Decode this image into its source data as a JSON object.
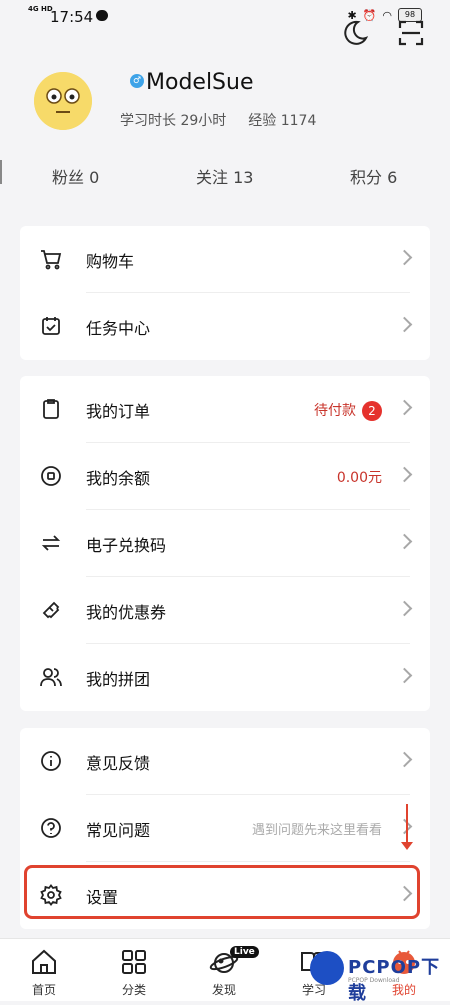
{
  "status_bar": {
    "network": "4G HD",
    "time": "17:54",
    "battery": "98"
  },
  "profile": {
    "username": "ModelSue",
    "gender_symbol": "♂",
    "study_time_label": "学习时长",
    "study_time_value": "29小时",
    "exp_label": "经验",
    "exp_value": "1174"
  },
  "counts": [
    {
      "label": "粉丝",
      "value": "0"
    },
    {
      "label": "关注",
      "value": "13"
    },
    {
      "label": "积分",
      "value": "6"
    }
  ],
  "group1": [
    {
      "label": "购物车",
      "icon": "cart-icon"
    },
    {
      "label": "任务中心",
      "icon": "calendar-check-icon"
    }
  ],
  "group2": [
    {
      "label": "我的订单",
      "icon": "clipboard-icon",
      "status": "待付款",
      "badge": "2"
    },
    {
      "label": "我的余额",
      "icon": "coin-icon",
      "amount": "0.00元"
    },
    {
      "label": "电子兑换码",
      "icon": "exchange-icon"
    },
    {
      "label": "我的优惠券",
      "icon": "ticket-icon"
    },
    {
      "label": "我的拼团",
      "icon": "group-icon"
    }
  ],
  "group3": [
    {
      "label": "意见反馈",
      "icon": "info-icon"
    },
    {
      "label": "常见问题",
      "icon": "question-icon",
      "hint": "遇到问题先来这里看看"
    },
    {
      "label": "设置",
      "icon": "gear-icon"
    }
  ],
  "tabs": [
    {
      "label": "首页",
      "icon": "home-icon"
    },
    {
      "label": "分类",
      "icon": "grid-icon"
    },
    {
      "label": "发现",
      "icon": "planet-icon",
      "badge": "Live"
    },
    {
      "label": "学习",
      "icon": "book-icon"
    },
    {
      "label": "我的",
      "icon": "profile-icon"
    }
  ],
  "colors": {
    "accent": "#e0432f",
    "badge": "#e5322d",
    "status_red": "#c8342b"
  },
  "watermark": {
    "text": "PCPOP下载",
    "sub": "PCPOP Download"
  }
}
